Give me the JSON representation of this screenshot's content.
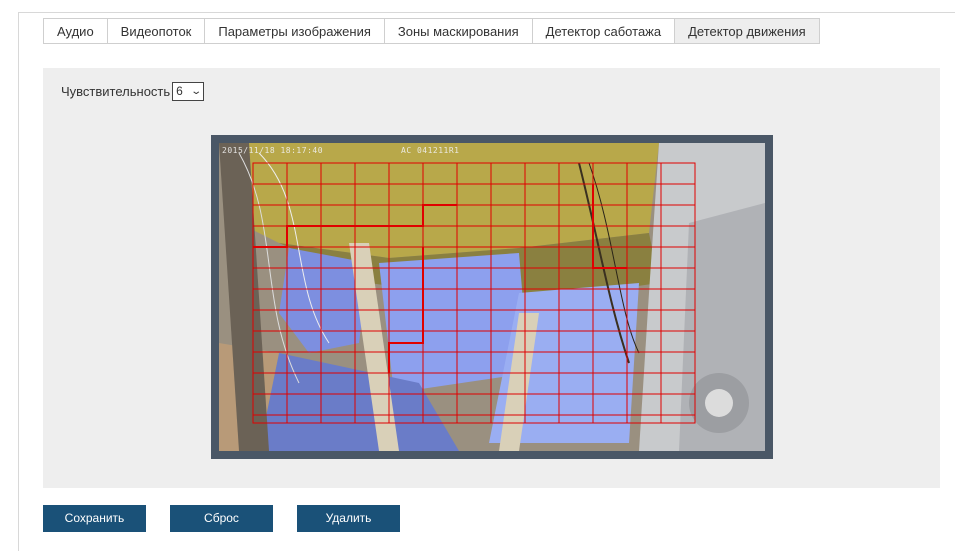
{
  "tabs": [
    {
      "label": "Аудио"
    },
    {
      "label": "Видеопоток"
    },
    {
      "label": "Параметры изображения"
    },
    {
      "label": "Зоны маскирования"
    },
    {
      "label": "Детектор саботажа"
    },
    {
      "label": "Детектор движения",
      "active": true
    }
  ],
  "sensitivity": {
    "label": "Чувствительность",
    "value": "6"
  },
  "video": {
    "timestamp": "2015/11/18 18:17:40",
    "camera_id": "AC 041211R1",
    "grid_color": "#e00000"
  },
  "buttons": {
    "save": "Сохранить",
    "reset": "Сброс",
    "delete": "Удалить"
  },
  "colors": {
    "button_bg": "#1a5178",
    "panel_bg": "#eeeeee",
    "frame_bg": "#4a5766"
  }
}
